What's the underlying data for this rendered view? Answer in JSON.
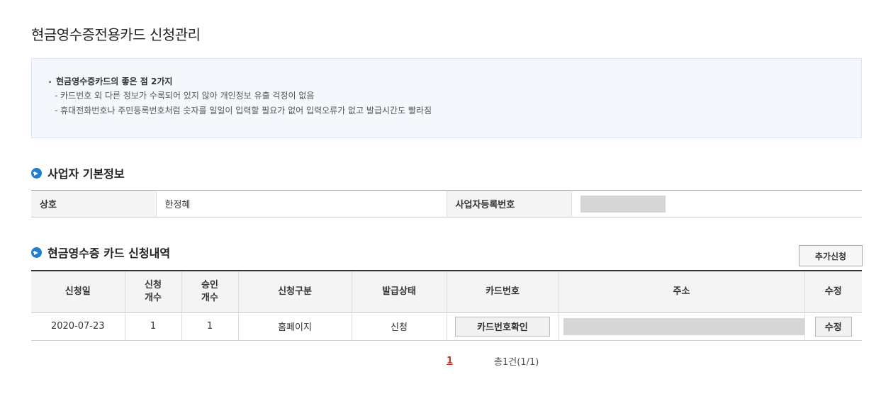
{
  "page": {
    "title": "현금영수증전용카드 신청관리"
  },
  "info": {
    "heading": "현금영수증카드의 좋은 점 2가지",
    "lines": [
      "- 카드번호 외 다른 정보가 수록되어 있지 않아 개인정보 유출 걱정이 없음",
      "- 휴대전화번호나 주민등록번호처럼 숫자를 일일이 입력할 필요가 없어 입력오류가 없고 발급시간도 빨라짐"
    ]
  },
  "business": {
    "title": "사업자 기본정보",
    "name_label": "상호",
    "name_value": "한정혜",
    "regno_label": "사업자등록번호"
  },
  "requests": {
    "title": "현금영수증 카드 신청내역",
    "add_button": "추가신청",
    "headers": {
      "date": "신청일",
      "req_count_1": "신청",
      "req_count_2": "개수",
      "appr_count_1": "승인",
      "appr_count_2": "개수",
      "type": "신청구분",
      "status": "발급상태",
      "card": "카드번호",
      "address": "주소",
      "edit": "수정"
    },
    "rows": [
      {
        "date": "2020-07-23",
        "req_count": "1",
        "appr_count": "1",
        "type": "홈페이지",
        "status": "신청",
        "card_button": "카드번호확인",
        "edit_button": "수정"
      }
    ]
  },
  "pagination": {
    "current": "1",
    "total": "총1건(1/1)"
  }
}
